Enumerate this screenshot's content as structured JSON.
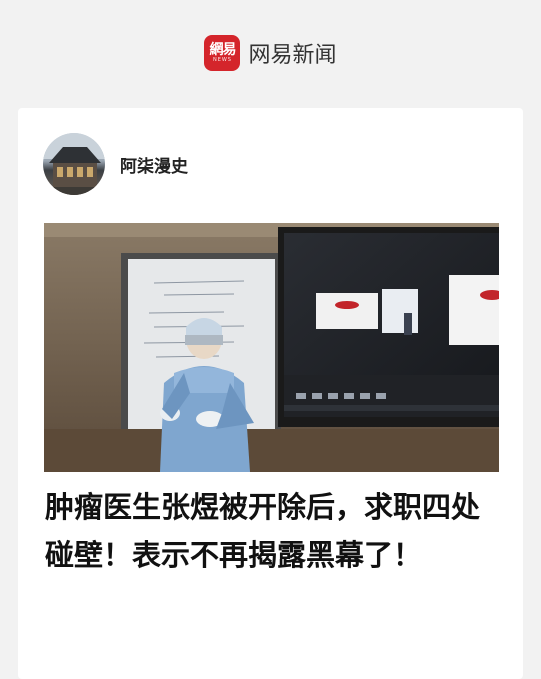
{
  "header": {
    "logo_text": "網易",
    "logo_sub": "NEWS",
    "app_name": "网易新闻",
    "brand_color": "#d4252b"
  },
  "article": {
    "author": "阿柒漫史",
    "headline": "肿瘤医生张煜被开除后，求职四处碰壁！表示不再揭露黑幕了！"
  }
}
